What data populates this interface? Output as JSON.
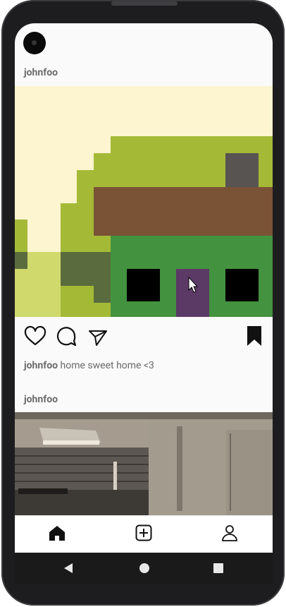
{
  "post1": {
    "username": "johnfoo",
    "caption_user": "johnfoo",
    "caption_text": "home sweet home <3",
    "image_icon": "pixel-art-house-image"
  },
  "post2": {
    "username": "johnfoo",
    "image_icon": "kitchen-photo-image"
  },
  "post_actions": [
    "heart-icon",
    "comment-icon",
    "send-icon",
    "bookmark-icon"
  ],
  "bottom_nav": [
    "home-icon",
    "add-post-icon",
    "profile-icon"
  ],
  "system_nav": [
    "back-icon",
    "home-circle-icon",
    "recents-icon"
  ],
  "colors": {
    "sky": "#fdf4d0",
    "bush": "#a4ba37",
    "roof": "#7a5236",
    "house": "#43923f",
    "door": "#5b3a66",
    "ground": "#cfd96c"
  }
}
